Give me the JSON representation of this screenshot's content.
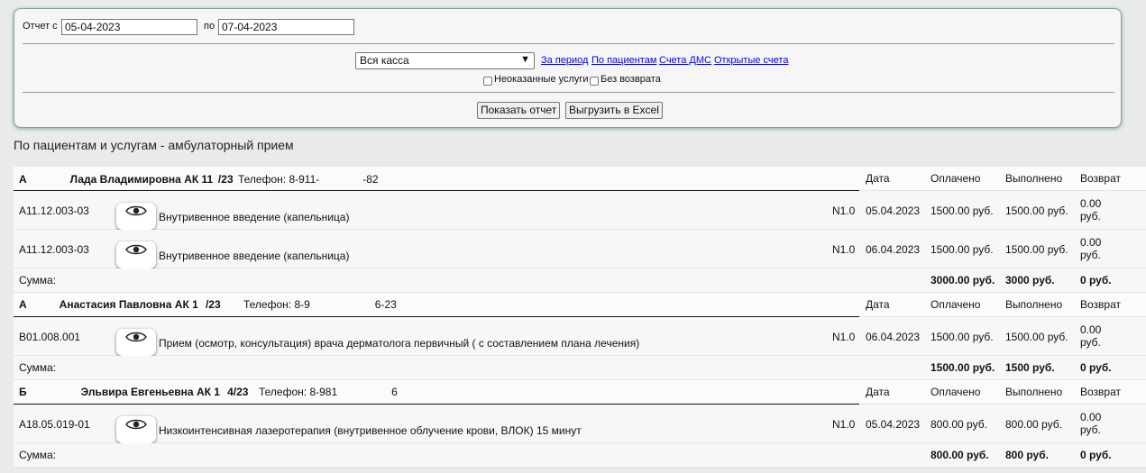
{
  "filter": {
    "from_label": "Отчет с",
    "from_value": "05-04-2023",
    "to_label": "по",
    "to_value": "07-04-2023",
    "cash_select": "Вся касса",
    "links": [
      "За период",
      "По пациентам",
      "Счета ДМС",
      "Открытые счета"
    ],
    "check_unrendered": "Неоказанные услуги",
    "check_noreturn": "Без возврата",
    "btn_show": "Показать отчет",
    "btn_excel": "Выгрузить в Excel"
  },
  "report_title": "По пациентам и услугам - амбулаторный прием",
  "columns": {
    "date": "Дата",
    "paid": "Оплачено",
    "done": "Выполнено",
    "ret": "Возврат"
  },
  "sum_label": "Сумма:",
  "groups": [
    {
      "patient": "А    Лада Владимировна АК 11   /23",
      "phone": "Телефон: 8-911-    -82",
      "items": [
        {
          "code": "A11.12.003-03",
          "service": "Внутривенное введение (капельница)",
          "n": "N1.0",
          "date": "05.04.2023",
          "paid": "1500.00 руб.",
          "done": "1500.00 руб.",
          "ret1": "0.00",
          "ret2": "руб."
        },
        {
          "code": "A11.12.003-03",
          "service": "Внутривенное введение (капельница)",
          "n": "N1.0",
          "date": "06.04.2023",
          "paid": "1500.00 руб.",
          "done": "1500.00 руб.",
          "ret1": "0.00",
          "ret2": "руб."
        }
      ],
      "sum": {
        "paid": "3000.00 руб.",
        "done": "3000 руб.",
        "ret": "0 руб."
      }
    },
    {
      "patient": "А   Анастасия Павловна АК 1   /23",
      "phone": "Телефон: 8-9      6-23",
      "items": [
        {
          "code": "B01.008.001",
          "service": "Прием (осмотр, консультация) врача дерматолога первичный ( с составлением плана лечения)",
          "n": "N1.0",
          "date": "06.04.2023",
          "paid": "1500.00 руб.",
          "done": "1500.00 руб.",
          "ret1": "0.00",
          "ret2": "руб."
        }
      ],
      "sum": {
        "paid": "1500.00 руб.",
        "done": "1500 руб.",
        "ret": "0 руб."
      }
    },
    {
      "patient": "Б     Эльвира Евгеньевна АК 1   4/23",
      "phone": "Телефон: 8-981     6",
      "items": [
        {
          "code": "A18.05.019-01",
          "service": "Низкоинтенсивная лазеротерапия (внутривенное облучение крови, ВЛОК) 15 минут",
          "n": "N1.0",
          "date": "05.04.2023",
          "paid": "800.00 руб.",
          "done": "800.00 руб.",
          "ret1": "0.00",
          "ret2": "руб."
        }
      ],
      "sum": {
        "paid": "800.00 руб.",
        "done": "800 руб.",
        "ret": "0 руб."
      }
    }
  ]
}
